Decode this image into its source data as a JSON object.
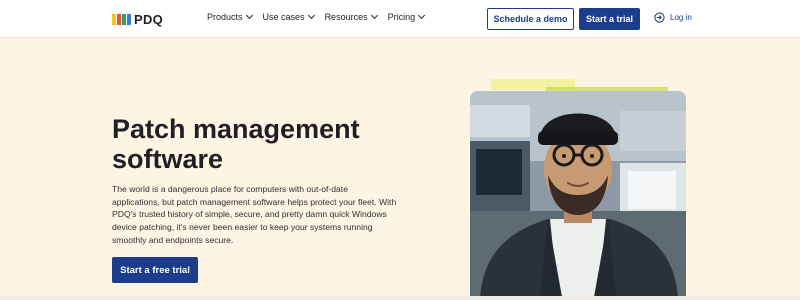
{
  "nav": {
    "logo_text": "PDQ",
    "logo_colors": [
      "#f5c518",
      "#e8552c",
      "#2f9e6b",
      "#3a7bd5"
    ],
    "menu": [
      {
        "label": "Products"
      },
      {
        "label": "Use cases"
      },
      {
        "label": "Resources"
      },
      {
        "label": "Pricing"
      }
    ],
    "demo_label": "Schedule a demo",
    "trial_label": "Start a trial",
    "login_label": "Log in",
    "login_icon": "login-arrow-icon"
  },
  "hero": {
    "title": "Patch management software",
    "body": "The world is a dangerous place for computers with out-of-date applications, but patch management software helps protect your fleet. With PDQ's trusted history of simple, secure, and pretty damn quick Windows device patching, it's never been easier to keep your systems running smoothly and endpoints secure.",
    "cta_label": "Start a free trial"
  },
  "colors": {
    "brand_blue": "#1c3d8c",
    "hero_bg": "#fdf4e3",
    "highlight_yellow": "#f3f199",
    "highlight_green": "#c8e15a"
  }
}
